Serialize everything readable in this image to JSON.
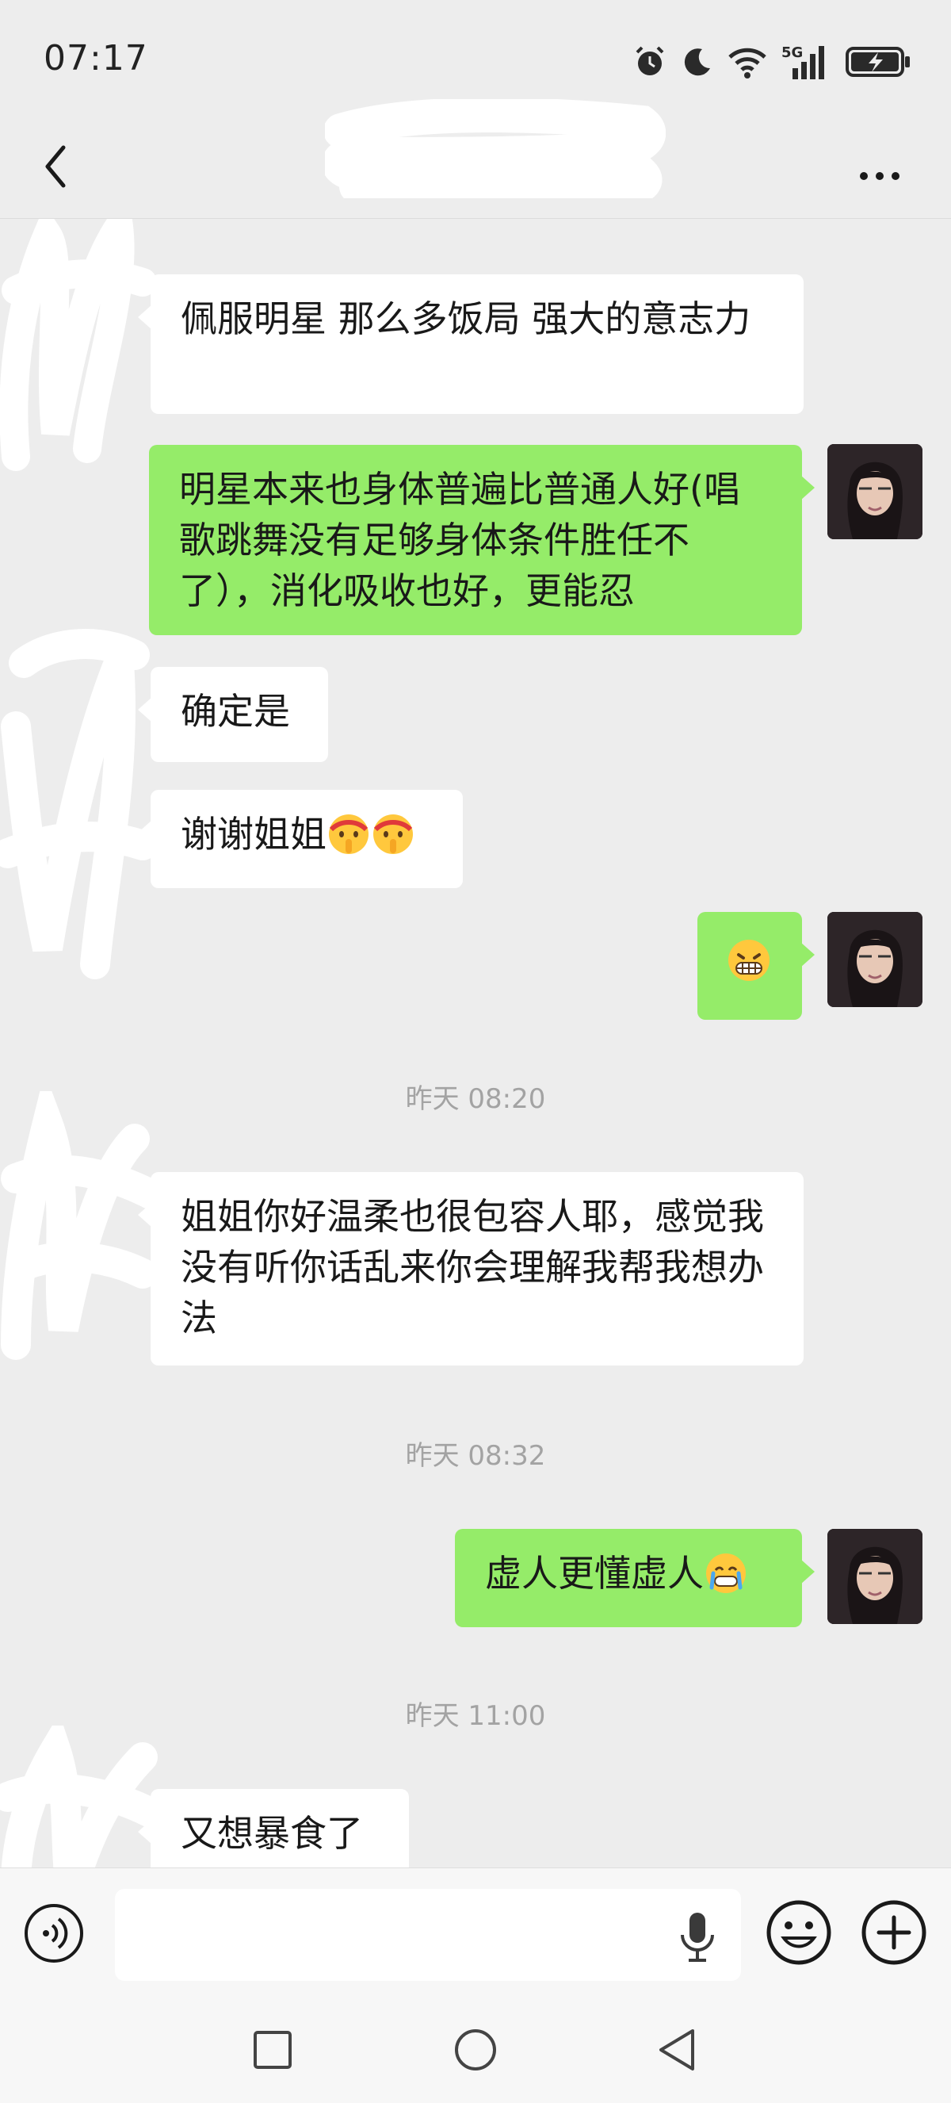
{
  "status_bar": {
    "time": "07:17",
    "icons": [
      "alarm-icon",
      "moon-icon",
      "wifi-icon",
      "signal-5g-icon",
      "battery-charging-icon"
    ],
    "network": "5G"
  },
  "header": {
    "title": "",
    "back_icon": "chevron-left-icon",
    "more_icon": "ellipsis-icon"
  },
  "messages": [
    {
      "side": "incoming",
      "text": "佩服明星 那么多饭局 强大的意志力"
    },
    {
      "side": "outgoing",
      "text": "明星本来也身体普遍比普通人好(唱歌跳舞没有足够身体条件胜任不了），消化吸收也好，更能忍"
    },
    {
      "side": "incoming",
      "text": "确定是"
    },
    {
      "side": "incoming",
      "text": "谢谢姐姐",
      "emojis": [
        "shush-face-emoji",
        "shush-face-emoji"
      ]
    },
    {
      "side": "outgoing",
      "text": "",
      "emojis": [
        "grimacing-face-emoji"
      ]
    },
    {
      "side": "incoming",
      "text": "姐姐你好温柔也很包容人耶，感觉我没有听你话乱来你会理解我帮我想办法"
    },
    {
      "side": "outgoing",
      "text": "虚人更懂虚人",
      "emojis": [
        "crying-face-emoji"
      ]
    },
    {
      "side": "incoming",
      "text": "又想暴食了"
    }
  ],
  "timestamps": [
    "昨天 08:20",
    "昨天 08:32",
    "昨天 11:00"
  ],
  "input_bar": {
    "placeholder": "",
    "icons": [
      "voice-icon",
      "mic-icon",
      "emoji-icon",
      "plus-icon"
    ]
  },
  "nav_bar": {
    "icons": [
      "recents-square-icon",
      "home-circle-icon",
      "back-triangle-icon"
    ]
  },
  "colors": {
    "background": "#ededed",
    "incoming_bubble": "#ffffff",
    "outgoing_bubble": "#95ec69",
    "timestamp": "#a3a3a3"
  }
}
